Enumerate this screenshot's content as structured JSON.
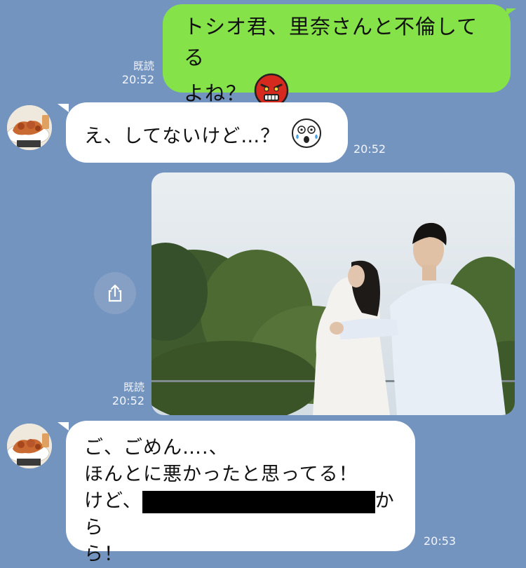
{
  "theme": {
    "background": "#7494c0",
    "outgoing_bubble": "#85e249",
    "incoming_bubble": "#ffffff"
  },
  "messages": [
    {
      "direction": "outgoing",
      "lines": [
        "トシオ君、里奈さんと不倫してる",
        "よね？"
      ],
      "sticker": "angry-red-face-emoji",
      "read_label": "既読",
      "time": "20:52"
    },
    {
      "direction": "incoming",
      "text": "え、してないけど…？",
      "sticker": "shocked-face-emoji",
      "time": "20:52"
    },
    {
      "direction": "outgoing",
      "type": "photo",
      "photo_description": "couple-outdoors-photo",
      "share_icon": "share-icon",
      "read_label": "既読",
      "time": "20:52"
    },
    {
      "direction": "incoming",
      "lines": [
        "ご、ごめん….、",
        "ほんとに悪かったと思ってる！",
        "けど、",
        "から",
        "ら！"
      ],
      "redacted": true,
      "time": "20:53"
    }
  ]
}
